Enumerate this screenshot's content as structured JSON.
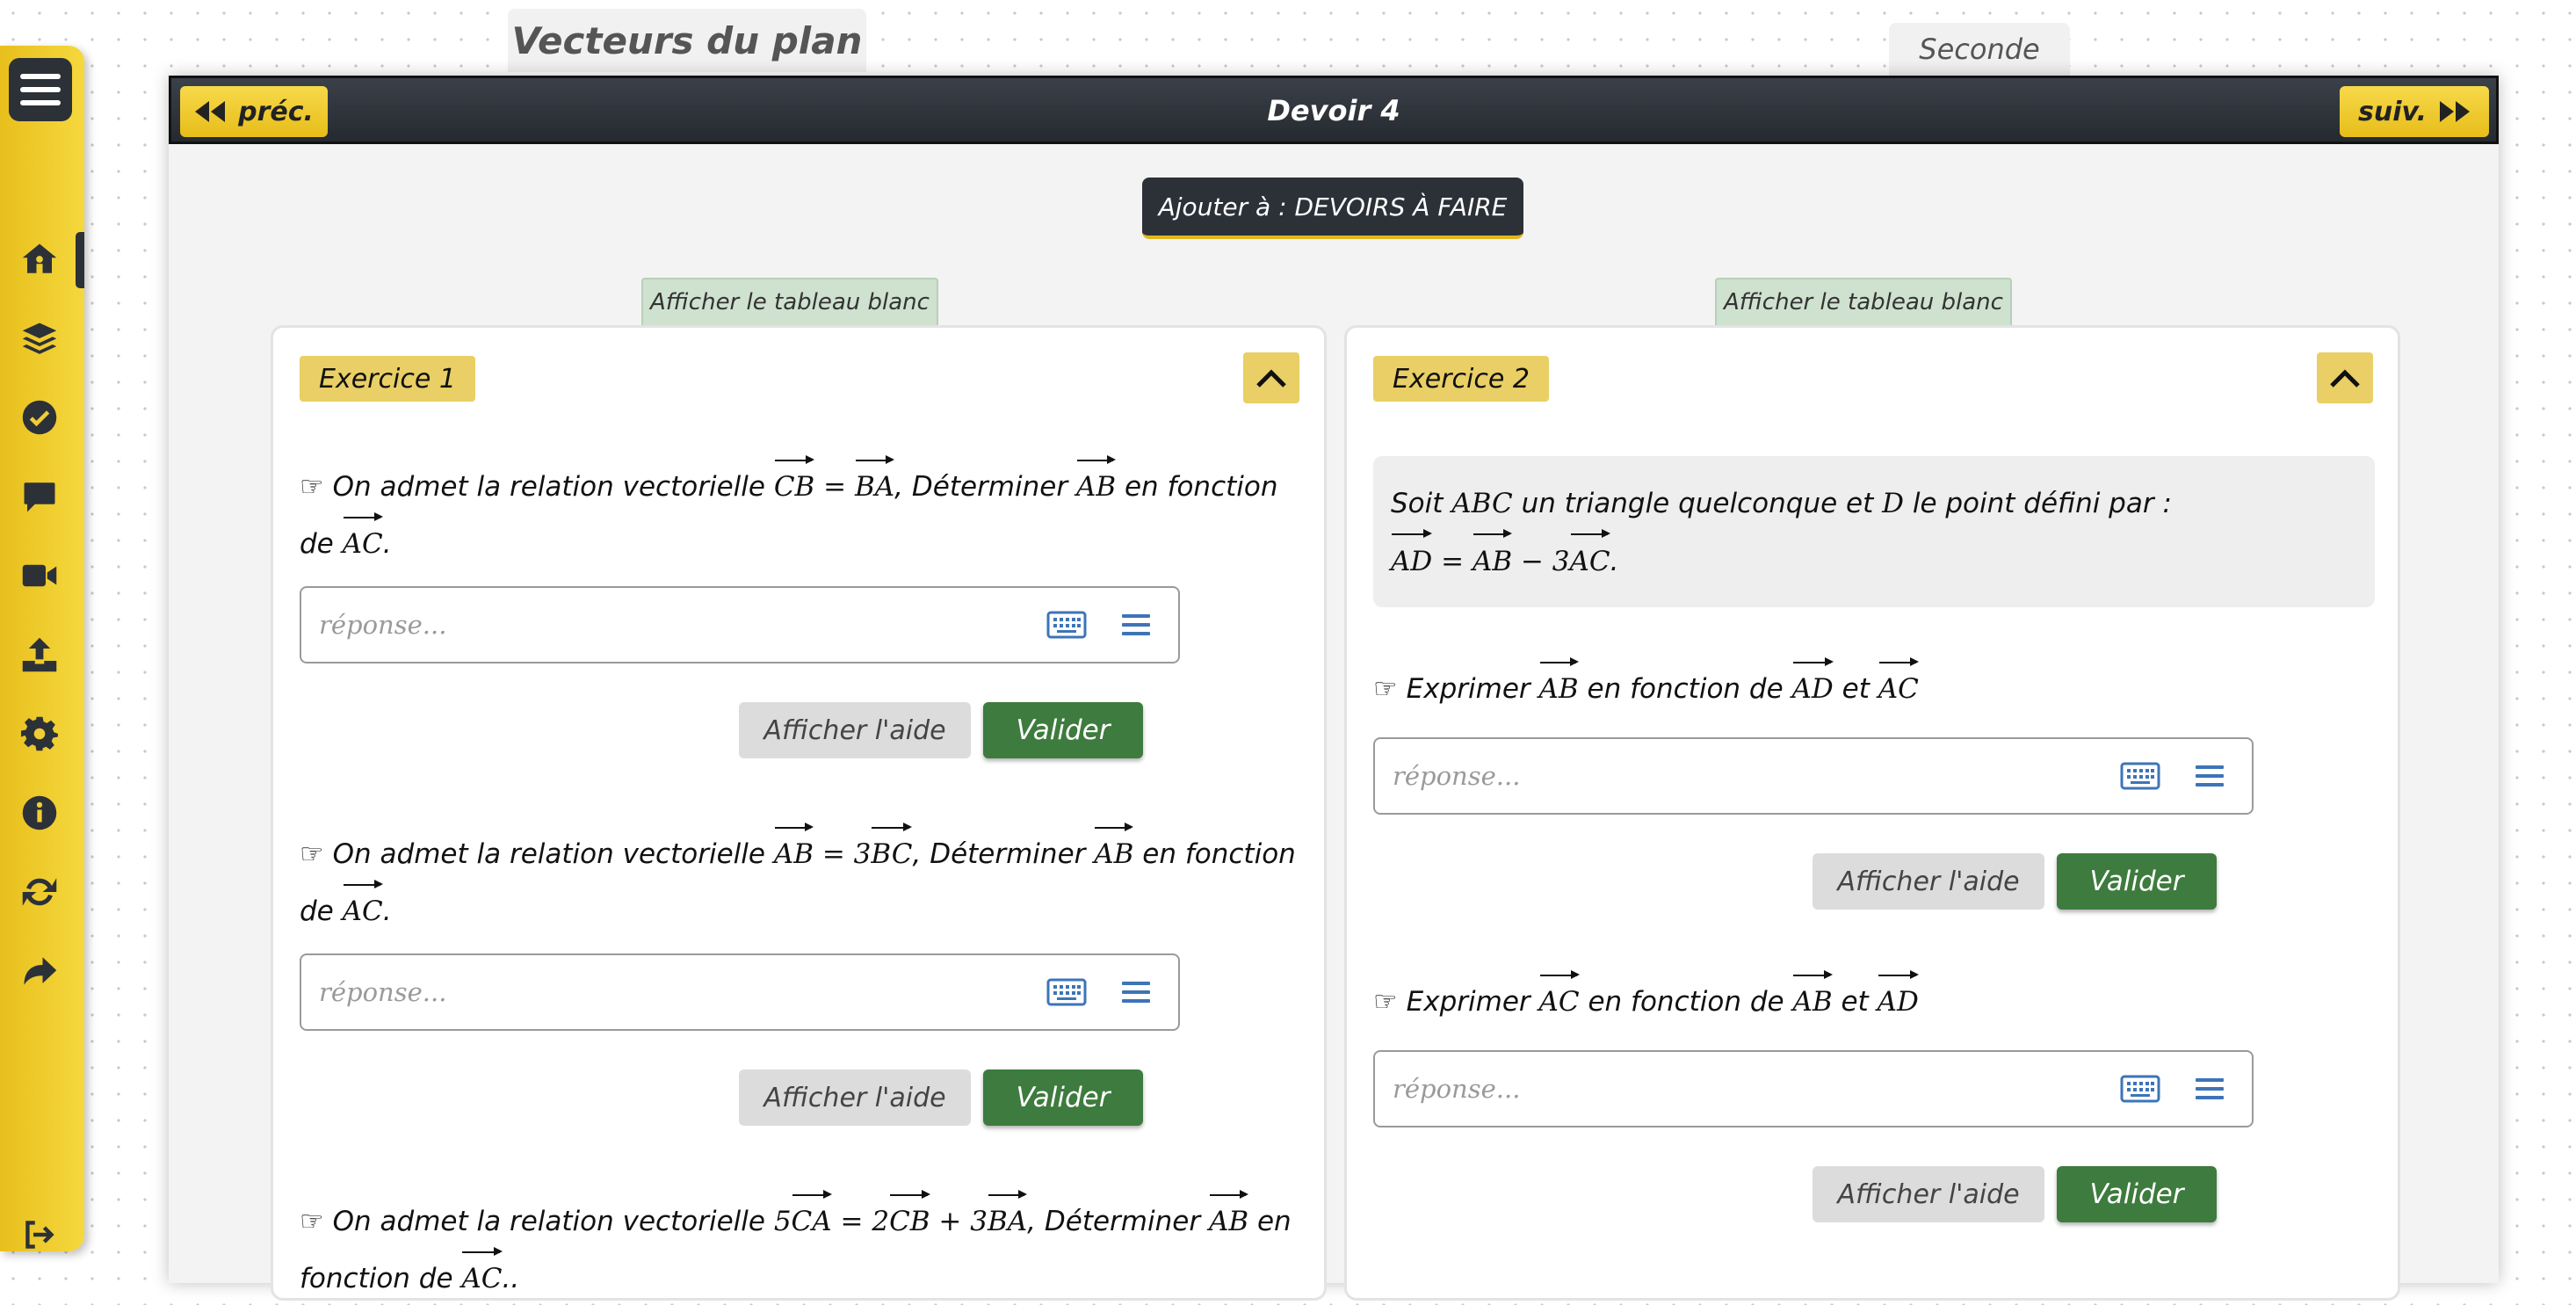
{
  "header": {
    "title": "Vecteurs du plan",
    "level": "Seconde"
  },
  "nav": {
    "prev_label": "préc.",
    "title": "Devoir 4",
    "next_label": "suiv."
  },
  "add_button_label": "Ajouter à : DEVOIRS À FAIRE",
  "sidebar": {
    "items": [
      "menu-icon",
      "home-icon",
      "layers-icon",
      "check-circle-icon",
      "chat-icon",
      "video-icon",
      "upload-icon",
      "gear-icon",
      "info-icon",
      "sync-icon",
      "share-icon",
      "logout-icon"
    ]
  },
  "colors": {
    "accent_yellow": "#f0cd34",
    "dark": "#2c3138",
    "validate_green": "#3e7b3e",
    "whiteboard_green": "#cfe1cf",
    "badge_yellow": "#e9cf65"
  },
  "exercise1": {
    "whiteboard_label": "Afficher le tableau blanc",
    "badge": "Exercice 1",
    "q1": {
      "pointer": "☞",
      "prefix": "On admet la relation vectorielle ",
      "v1": "CB",
      "eq": " = ",
      "v2": "BA",
      "mid": ", Déterminer ",
      "v3": "AB",
      "suffix": " en fonction de ",
      "v4": "AC",
      "end": "."
    },
    "q2": {
      "pointer": "☞",
      "prefix": "On admet la relation vectorielle ",
      "v1": "AB",
      "eq": " = ",
      "coef": "3",
      "v2": "BC",
      "mid": ", Déterminer ",
      "v3": "AB",
      "suffix": " en fonction de ",
      "v4": "AC",
      "end": "."
    },
    "q3": {
      "pointer": "☞",
      "prefix": "On admet la relation vectorielle ",
      "c1": "5",
      "v1": "CA",
      "eq": " = ",
      "c2": "2",
      "v2": "CB",
      "plus": " + ",
      "c3": "3",
      "v3": "BA",
      "mid": ", Déterminer ",
      "v4": "AB",
      "suffix": " en fonction de ",
      "v5": "AC",
      "end": ".."
    },
    "placeholder": "réponse...",
    "help_label": "Afficher l'aide",
    "validate_label": "Valider"
  },
  "exercise2": {
    "whiteboard_label": "Afficher le tableau blanc",
    "badge": "Exercice 2",
    "statement": {
      "p1": "Soit ",
      "abc": "ABC",
      "p2": " un triangle quelconque et ",
      "d": "D",
      "p3": " le point défini par :",
      "v1": "AD",
      "eq": " = ",
      "v2": "AB",
      "minus": " − ",
      "coef": "3",
      "v3": "AC",
      "end": "."
    },
    "q1": {
      "pointer": "☞",
      "prefix": "Exprimer ",
      "v1": "AB",
      "mid": " en fonction de ",
      "v2": "AD",
      "and": " et ",
      "v3": "AC"
    },
    "q2": {
      "pointer": "☞",
      "prefix": "Exprimer ",
      "v1": "AC",
      "mid": " en fonction de ",
      "v2": "AB",
      "and": " et ",
      "v3": "AD"
    },
    "placeholder": "réponse...",
    "help_label": "Afficher l'aide",
    "validate_label": "Valider"
  }
}
